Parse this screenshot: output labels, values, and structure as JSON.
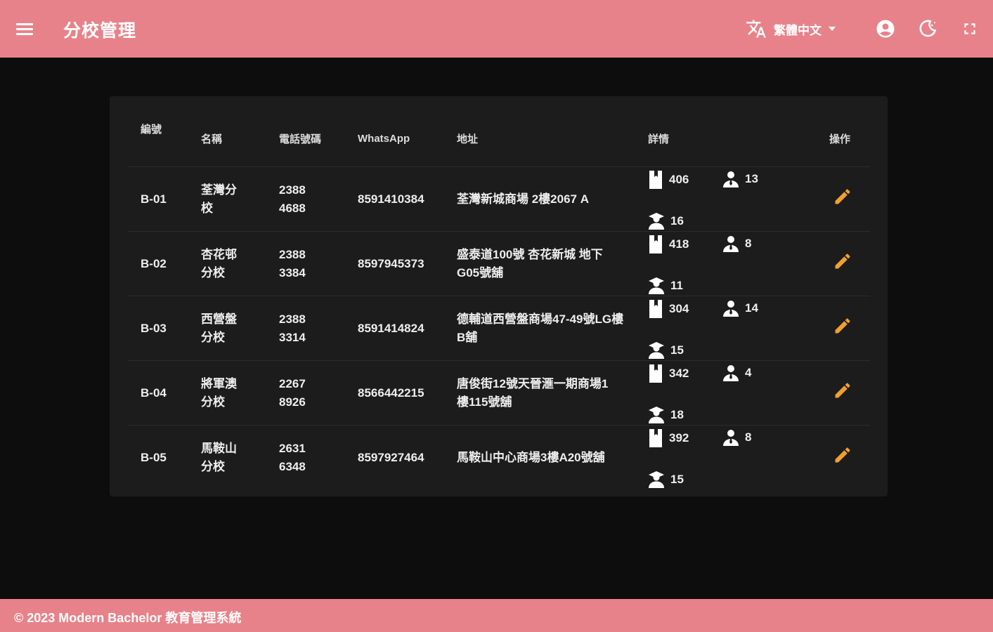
{
  "header": {
    "title": "分校管理",
    "language_label": "繁體中文"
  },
  "table": {
    "columns": {
      "code": "編號",
      "name": "名稱",
      "phone": "電話號碼",
      "whatsapp": "WhatsApp",
      "address": "地址",
      "details": "詳情",
      "operations": "操作"
    },
    "rows": [
      {
        "code": "B-01",
        "name": [
          "荃灣分",
          "校"
        ],
        "phone": [
          "2388",
          "4688"
        ],
        "whatsapp": "8591410384",
        "address": [
          "荃灣新城商場 2樓2067 A"
        ],
        "books": "406",
        "teachers": "13",
        "students": "16"
      },
      {
        "code": "B-02",
        "name": [
          "杏花邨",
          "分校"
        ],
        "phone": [
          "2388",
          "3384"
        ],
        "whatsapp": "8597945373",
        "address": [
          "盛泰道100號 杏花新城 地下",
          "G05號舖"
        ],
        "books": "418",
        "teachers": "8",
        "students": "11"
      },
      {
        "code": "B-03",
        "name": [
          "西營盤",
          "分校"
        ],
        "phone": [
          "2388",
          "3314"
        ],
        "whatsapp": "8591414824",
        "address": [
          "德輔道西營盤商場47-49號LG樓",
          "B舖"
        ],
        "books": "304",
        "teachers": "14",
        "students": "15"
      },
      {
        "code": "B-04",
        "name": [
          "將軍澳",
          "分校"
        ],
        "phone": [
          "2267",
          "8926"
        ],
        "whatsapp": "8566442215",
        "address": [
          "唐俊街12號天晉滙一期商場1",
          "樓115號舖"
        ],
        "books": "342",
        "teachers": "4",
        "students": "18"
      },
      {
        "code": "B-05",
        "name": [
          "馬鞍山",
          "分校"
        ],
        "phone": [
          "2631",
          "6348"
        ],
        "whatsapp": "8597927464",
        "address": [
          "馬鞍山中心商場3樓A20號舖"
        ],
        "books": "392",
        "teachers": "8",
        "students": "15"
      }
    ]
  },
  "footer": {
    "text": "© 2023 Modern Bachelor 教育管理系統"
  },
  "colors": {
    "primary": "#e8828a",
    "background": "#0d0d0d",
    "card": "#1c1c1c",
    "edit_icon": "#f0a030"
  },
  "icons": [
    "menu-icon",
    "translate-icon",
    "account-icon",
    "theme-night-icon",
    "fullscreen-icon",
    "book-icon",
    "teacher-icon",
    "student-icon",
    "pencil-icon"
  ]
}
